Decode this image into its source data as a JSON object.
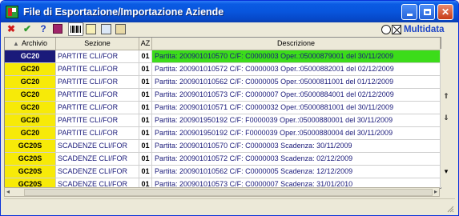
{
  "window": {
    "title": "File di Esportazione/Importazione Aziende",
    "brand": "Multidata"
  },
  "columns": {
    "archivio": "Archivio",
    "sezione": "Sezione",
    "az": "AZ",
    "descrizione": "Descrizione"
  },
  "rows": [
    {
      "archivio": "GC20",
      "sezione": "PARTITE CLI/FOR",
      "az": "01",
      "descrizione": "Partita: 200901010570 C/F: C0000003 Oper.:05000879001 del 30/11/2009",
      "selected": true
    },
    {
      "archivio": "GC20",
      "sezione": "PARTITE CLI/FOR",
      "az": "01",
      "descrizione": "Partita: 200901010572 C/F: C0000003 Oper.:05000882001 del 02/12/2009"
    },
    {
      "archivio": "GC20",
      "sezione": "PARTITE CLI/FOR",
      "az": "01",
      "descrizione": "Partita: 200901010562 C/F: C0000005 Oper.:05000811001 del 01/12/2009"
    },
    {
      "archivio": "GC20",
      "sezione": "PARTITE CLI/FOR",
      "az": "01",
      "descrizione": "Partita: 200901010573 C/F: C0000007 Oper.:05000884001 del 02/12/2009"
    },
    {
      "archivio": "GC20",
      "sezione": "PARTITE CLI/FOR",
      "az": "01",
      "descrizione": "Partita: 200901010571 C/F: C0000032 Oper.:05000881001 del 30/11/2009"
    },
    {
      "archivio": "GC20",
      "sezione": "PARTITE CLI/FOR",
      "az": "01",
      "descrizione": "Partita: 200901950192 C/F: F0000039 Oper.:05000880001 del 30/11/2009"
    },
    {
      "archivio": "GC20",
      "sezione": "PARTITE CLI/FOR",
      "az": "01",
      "descrizione": "Partita: 200901950192 C/F: F0000039 Oper.:05000880004 del 30/11/2009"
    },
    {
      "archivio": "GC20S",
      "sezione": "SCADENZE CLI/FOR",
      "az": "01",
      "descrizione": "Partita: 200901010570 C/F: C0000003 Scadenza: 30/11/2009"
    },
    {
      "archivio": "GC20S",
      "sezione": "SCADENZE CLI/FOR",
      "az": "01",
      "descrizione": "Partita: 200901010572 C/F: C0000003 Scadenza: 02/12/2009"
    },
    {
      "archivio": "GC20S",
      "sezione": "SCADENZE CLI/FOR",
      "az": "01",
      "descrizione": "Partita: 200901010562 C/F: C0000005 Scadenza: 12/12/2009"
    },
    {
      "archivio": "GC20S",
      "sezione": "SCADENZE CLI/FOR",
      "az": "01",
      "descrizione": "Partita: 200901010573 C/F: C0000007 Scadenza: 31/01/2010"
    }
  ],
  "colors": {
    "highlight_yellow": "#f7ea08",
    "selected_dark": "#1a1a7a",
    "selected_green": "#3cdc1a",
    "titlebar": "#0855dd"
  },
  "toolbar_icons": [
    "close-icon",
    "check-icon",
    "help-icon",
    "book-icon",
    "barcode-icon",
    "edit-icon",
    "copy-icon",
    "paste-icon"
  ]
}
